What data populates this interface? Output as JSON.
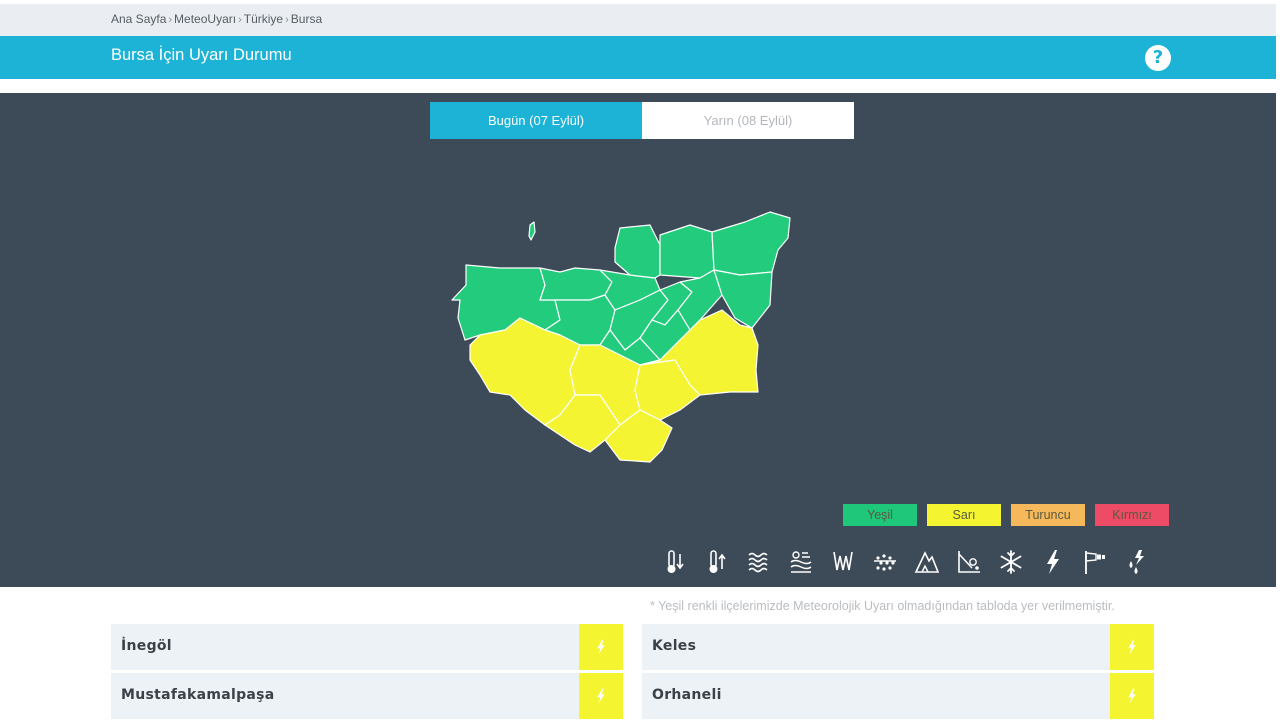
{
  "breadcrumb": {
    "items": [
      "Ana Sayfa",
      "MeteoUyarı",
      "Türkiye",
      "Bursa"
    ],
    "separator": "›"
  },
  "header": {
    "title": "Bursa İçin Uyarı Durumu",
    "help_label": "?"
  },
  "tabs": [
    {
      "label": "Bugün (07 Eylül)",
      "active": true
    },
    {
      "label": "Yarın (08 Eylül)",
      "active": false
    }
  ],
  "legend": [
    {
      "label": "Yeşil",
      "color": "#1fc77a"
    },
    {
      "label": "Sarı",
      "color": "#f4f431"
    },
    {
      "label": "Turuncu",
      "color": "#f5b85a"
    },
    {
      "label": "Kırmızı",
      "color": "#ee4b66"
    }
  ],
  "map_colors": {
    "green": "#22cc7c",
    "yellow": "#f4f433",
    "background": "#3d4a57"
  },
  "weather_icons": [
    "low-temperature-icon",
    "high-temperature-icon",
    "fog-icon",
    "dust-storm-icon",
    "rain-icon",
    "hail-icon",
    "avalanche-icon",
    "landslide-icon",
    "snow-icon",
    "thunderstorm-icon",
    "wind-icon",
    "lightning-rain-icon"
  ],
  "note": "* Yeşil renkli ilçelerimizde Meteorolojik Uyarı olmadığından tabloda yer verilmemiştir.",
  "districts": [
    {
      "name": "İnegöl",
      "warning_icon": "thunderstorm-icon",
      "level_color": "#f4f431"
    },
    {
      "name": "Keles",
      "warning_icon": "thunderstorm-icon",
      "level_color": "#f4f431"
    },
    {
      "name": "Mustafakamalpaşa",
      "warning_icon": "thunderstorm-icon",
      "level_color": "#f4f431"
    },
    {
      "name": "Orhaneli",
      "warning_icon": "thunderstorm-icon",
      "level_color": "#f4f431"
    }
  ]
}
